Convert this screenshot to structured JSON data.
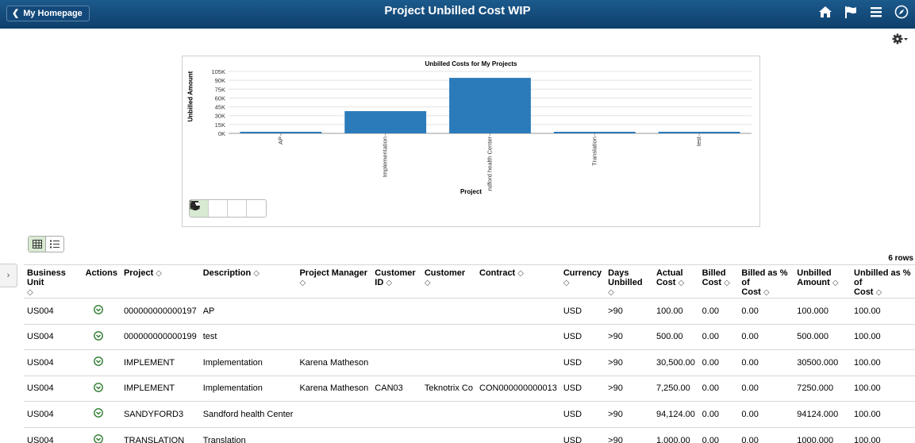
{
  "banner": {
    "home_label": "My Homepage",
    "title": "Project Unbilled Cost WIP",
    "icons": [
      "home-icon",
      "flag-icon",
      "menu-icon",
      "compass-icon"
    ]
  },
  "settings": {
    "icon": "gear-icon"
  },
  "chart_data": {
    "type": "bar",
    "title": "Unbilled Costs for My Projects",
    "xlabel": "Project",
    "ylabel": "Unbilled Amount",
    "categories": [
      "AP",
      "Implementation",
      "Sandford health Center",
      "Translation",
      "test"
    ],
    "values": [
      100,
      37750,
      94124,
      1000,
      500
    ],
    "ylim": [
      0,
      105000
    ],
    "yticks": [
      "105K",
      "90K",
      "75K",
      "60K",
      "45K",
      "30K",
      "15K",
      "0K"
    ],
    "ytick_values": [
      105000,
      90000,
      75000,
      60000,
      45000,
      30000,
      15000,
      0
    ],
    "bar_color": "#2b7bba",
    "grid": true
  },
  "chart_type_buttons": [
    "bar-chart-icon",
    "line-chart-icon",
    "pie-chart-icon",
    "horizontal-bar-icon"
  ],
  "view_toggle": [
    "grid-view-icon",
    "list-view-icon"
  ],
  "grid": {
    "row_count_label": "6 rows",
    "side_tab_glyph": "›",
    "sort_glyph": "◇",
    "columns": [
      {
        "line1": "Business Unit",
        "line2": ""
      },
      {
        "line1": "Actions",
        "line2": ""
      },
      {
        "line1": "Project",
        "line2": ""
      },
      {
        "line1": "Description",
        "line2": ""
      },
      {
        "line1": "Project Manager",
        "line2": ""
      },
      {
        "line1": "Customer",
        "line2": "ID"
      },
      {
        "line1": "Customer",
        "line2": ""
      },
      {
        "line1": "Contract",
        "line2": ""
      },
      {
        "line1": "Currency",
        "line2": ""
      },
      {
        "line1": "Days",
        "line2": "Unbilled"
      },
      {
        "line1": "Actual",
        "line2": "Cost"
      },
      {
        "line1": "Billed",
        "line2": "Cost"
      },
      {
        "line1": "Billed as % of",
        "line2": "Cost"
      },
      {
        "line1": "Unbilled",
        "line2": "Amount"
      },
      {
        "line1": "Unbilled as % of",
        "line2": "Cost"
      }
    ],
    "rows": [
      [
        "US004",
        "",
        "000000000000197",
        "AP",
        "",
        "",
        "",
        "",
        "USD",
        ">90",
        "100.00",
        "0.00",
        "0.00",
        "100.000",
        "100.00"
      ],
      [
        "US004",
        "",
        "000000000000199",
        "test",
        "",
        "",
        "",
        "",
        "USD",
        ">90",
        "500.00",
        "0.00",
        "0.00",
        "500.000",
        "100.00"
      ],
      [
        "US004",
        "",
        "IMPLEMENT",
        "Implementation",
        "Karena Matheson",
        "",
        "",
        "",
        "USD",
        ">90",
        "30,500.00",
        "0.00",
        "0.00",
        "30500.000",
        "100.00"
      ],
      [
        "US004",
        "",
        "IMPLEMENT",
        "Implementation",
        "Karena Matheson",
        "CAN03",
        "Teknotrix Co",
        "CON000000000013",
        "USD",
        ">90",
        "7,250.00",
        "0.00",
        "0.00",
        "7250.000",
        "100.00"
      ],
      [
        "US004",
        "",
        "SANDYFORD3",
        "Sandford health Center",
        "",
        "",
        "",
        "",
        "USD",
        ">90",
        "94,124.00",
        "0.00",
        "0.00",
        "94124.000",
        "100.00"
      ],
      [
        "US004",
        "",
        "TRANSLATION",
        "Translation",
        "",
        "",
        "",
        "",
        "USD",
        ">90",
        "1,000.00",
        "0.00",
        "0.00",
        "1000.000",
        "100.00"
      ]
    ]
  }
}
